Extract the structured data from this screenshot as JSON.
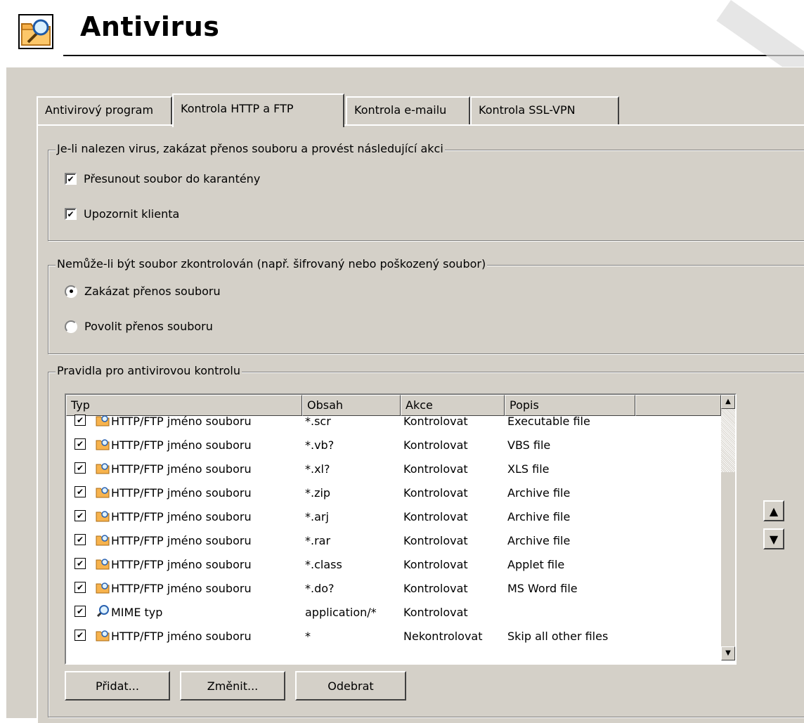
{
  "app": {
    "title": "Antivirus",
    "icon": "antivirus-folder-magnifier-icon"
  },
  "tabs": [
    {
      "label": "Antivirový program",
      "active": false
    },
    {
      "label": "Kontrola HTTP a FTP",
      "active": true
    },
    {
      "label": "Kontrola e-mailu",
      "active": false
    },
    {
      "label": "Kontrola SSL-VPN",
      "active": false
    }
  ],
  "virus_found_group": {
    "title": "Je-li nalezen virus, zakázat přenos souboru a provést následující akci",
    "options": [
      {
        "label": "Přesunout soubor do karantény",
        "checked": true
      },
      {
        "label": "Upozornit klienta",
        "checked": true
      }
    ]
  },
  "cannot_check_group": {
    "title": "Nemůže-li být soubor zkontrolován (např. šifrovaný nebo poškozený soubor)",
    "options": [
      {
        "label": "Zakázat přenos souboru",
        "selected": true
      },
      {
        "label": "Povolit přenos souboru",
        "selected": false
      }
    ]
  },
  "rules_group": {
    "title": "Pravidla pro antivirovou kontrolu",
    "columns": [
      "Typ",
      "Obsah",
      "Akce",
      "Popis"
    ],
    "rows": [
      {
        "type": "HTTP/FTP jméno souboru",
        "icon": "file-folder-icon",
        "content": "*.scr",
        "action": "Kontrolovat",
        "description": "Executable file",
        "checked": true
      },
      {
        "type": "HTTP/FTP jméno souboru",
        "icon": "file-folder-icon",
        "content": "*.vb?",
        "action": "Kontrolovat",
        "description": "VBS file",
        "checked": true
      },
      {
        "type": "HTTP/FTP jméno souboru",
        "icon": "file-folder-icon",
        "content": "*.xl?",
        "action": "Kontrolovat",
        "description": "XLS file",
        "checked": true
      },
      {
        "type": "HTTP/FTP jméno souboru",
        "icon": "file-folder-icon",
        "content": "*.zip",
        "action": "Kontrolovat",
        "description": "Archive file",
        "checked": true
      },
      {
        "type": "HTTP/FTP jméno souboru",
        "icon": "file-folder-icon",
        "content": "*.arj",
        "action": "Kontrolovat",
        "description": "Archive file",
        "checked": true
      },
      {
        "type": "HTTP/FTP jméno souboru",
        "icon": "file-folder-icon",
        "content": "*.rar",
        "action": "Kontrolovat",
        "description": "Archive file",
        "checked": true
      },
      {
        "type": "HTTP/FTP jméno souboru",
        "icon": "file-folder-icon",
        "content": "*.class",
        "action": "Kontrolovat",
        "description": "Applet file",
        "checked": true
      },
      {
        "type": "HTTP/FTP jméno souboru",
        "icon": "file-folder-icon",
        "content": "*.do?",
        "action": "Kontrolovat",
        "description": "MS Word file",
        "checked": true
      },
      {
        "type": "MIME typ",
        "icon": "magnifier-icon",
        "content": "application/*",
        "action": "Kontrolovat",
        "description": "",
        "checked": true
      },
      {
        "type": "HTTP/FTP jméno souboru",
        "icon": "file-folder-icon",
        "content": "*",
        "action": "Nekontrolovat",
        "description": "Skip all other files",
        "checked": true
      }
    ],
    "buttons": {
      "add": "Přidat...",
      "edit": "Změnit...",
      "remove": "Odebrat"
    }
  }
}
